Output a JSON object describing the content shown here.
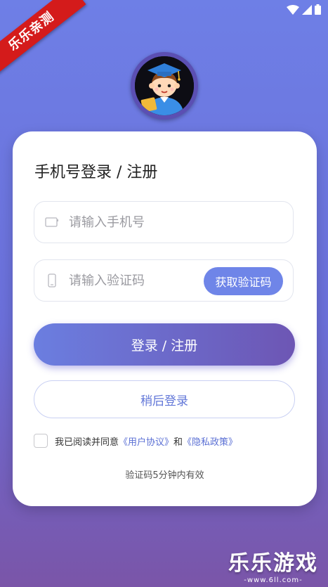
{
  "status_bar": {
    "icons": [
      "wifi-icon",
      "signal-icon",
      "battery-icon"
    ]
  },
  "corner_ribbon": {
    "text": "乐乐亲测"
  },
  "avatar": {
    "icon": "graduate-boy-avatar"
  },
  "card": {
    "title": "手机号登录 / 注册",
    "phone_input": {
      "placeholder": "请输入手机号",
      "value": "",
      "icon": "phone-card-icon"
    },
    "code_input": {
      "placeholder": "请输入验证码",
      "value": "",
      "icon": "phone-icon"
    },
    "get_code_button": "获取验证码",
    "login_button": "登录 / 注册",
    "later_button": "稍后登录",
    "agreement": {
      "prefix": "我已阅读并同意",
      "user_agreement": "《用户协议》",
      "and": "和",
      "privacy_policy": "《隐私政策》",
      "checked": false
    },
    "hint": "验证码5分钟内有效"
  },
  "watermark": {
    "title": "乐乐游戏",
    "url": "-www.6ll.com-"
  },
  "colors": {
    "accent": "#6f85e8",
    "gradient_start": "#6b7ee0",
    "gradient_end": "#6d56b4",
    "link": "#5a6fd4"
  }
}
